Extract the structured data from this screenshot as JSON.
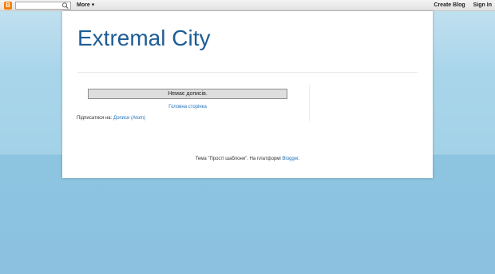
{
  "navbar": {
    "logo_letter": "B",
    "search_placeholder": "",
    "more_label": "More",
    "create_blog_label": "Create Blog",
    "sign_in_label": "Sign In"
  },
  "blog": {
    "title": "Extremal City",
    "no_posts_text": "Немає дописів.",
    "home_link_label": "Головна сторінка",
    "subscribe_label": "Підписатися на:",
    "subscribe_link_label": "Дописи (Atom)",
    "footer_text": "Тема \"Прості шаблони\". На платформі",
    "footer_link_label": "Blogger",
    "footer_suffix": "."
  },
  "colors": {
    "title": "#1e5d96",
    "link": "#1e73be",
    "background_top": "#a9d5ea",
    "background_bottom": "#8cc2df",
    "logo": "#f57d00"
  }
}
